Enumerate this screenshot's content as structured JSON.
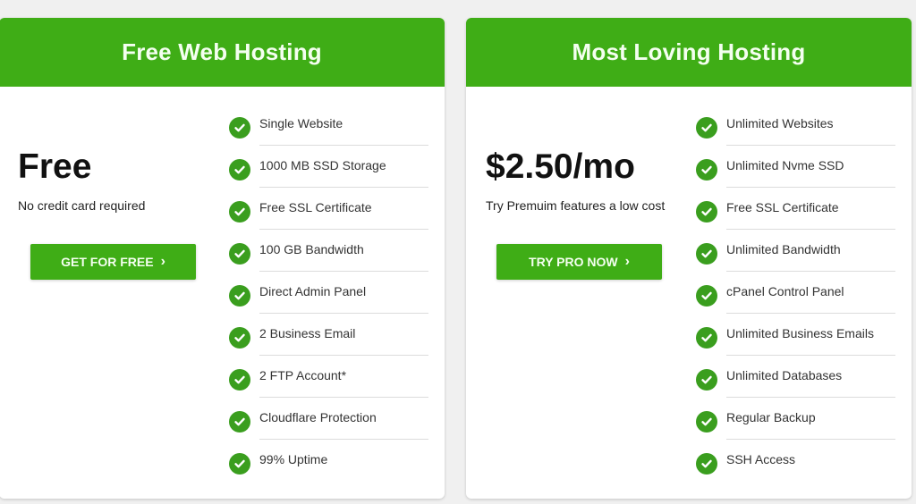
{
  "colors": {
    "brand_green": "#3fad16",
    "page_bg": "#f0f0f0"
  },
  "plans": [
    {
      "title": "Free Web Hosting",
      "price": "Free",
      "subtitle": "No credit card required",
      "cta_label": "GET FOR FREE",
      "cta_icon": "chevron-right-icon",
      "features": [
        "Single Website",
        "1000 MB SSD Storage",
        "Free SSL Certificate",
        "100 GB Bandwidth",
        "Direct Admin Panel",
        "2 Business Email",
        "2 FTP Account*",
        "Cloudflare Protection",
        "99% Uptime"
      ]
    },
    {
      "title": "Most Loving Hosting",
      "price": "$2.50/mo",
      "subtitle": "Try Premuim features a low cost",
      "cta_label": "TRY PRO NOW",
      "cta_icon": "chevron-right-icon",
      "features": [
        "Unlimited Websites",
        "Unlimited Nvme SSD",
        "Free SSL Certificate",
        "Unlimited Bandwidth",
        "cPanel Control Panel",
        "Unlimited Business Emails",
        "Unlimited Databases",
        "Regular Backup",
        "SSH Access"
      ]
    }
  ]
}
